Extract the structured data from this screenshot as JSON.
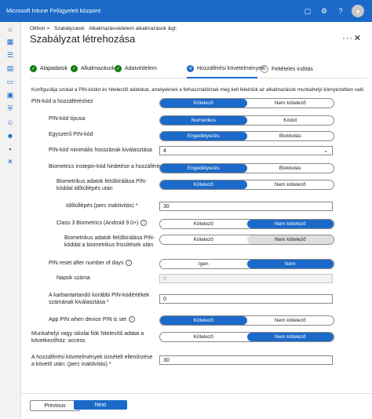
{
  "app": {
    "title": "Microsoft Intune Felügyeleti központ",
    "avatar_letter": "●"
  },
  "nav": [
    "home-icon",
    "dashboard-icon",
    "list-icon",
    "grid-icon",
    "devices-icon",
    "apps-icon",
    "shield-icon",
    "users-icon",
    "groups-icon",
    "admin-icon",
    "tools-icon"
  ],
  "breadcrumb": [
    "Otthon >",
    "Szabályzatok",
    "Alkalmazásvédelem alkalmazások &gt;"
  ],
  "page_title": "Szabályzat létrehozása",
  "more": "···",
  "close": "✕",
  "steps": [
    {
      "label": "Alapadatok",
      "state": "done"
    },
    {
      "label": "Alkalmazások",
      "state": "done"
    },
    {
      "label": "Adatvédelem",
      "state": "done"
    },
    {
      "num": "4",
      "label": "Hozzáférési követelmények",
      "state": "active"
    },
    {
      "num": "5",
      "label": "Feltételes indítás",
      "state": "todo"
    }
  ],
  "description": "Konfigurálja szokat a PIN-kódot és hitelesítő adatokat, amelyeknek a felhasználóknak meg kell felelniük az alkalmazások munkahelyi környezetben való eléréséhez.",
  "rows": {
    "pin_access": {
      "label": "PIN-kód a hozzáféréshez",
      "opt1": "Kötelező",
      "opt2": "Nem kötelező",
      "selected": 1
    },
    "pin_type": {
      "label": "PIN-kód típusa",
      "opt1": "Numerikus",
      "opt2": "Kódot",
      "selected": 1
    },
    "simple_pin": {
      "label": "Egyszerű PIN-kód",
      "opt1": "Engedélyezés",
      "opt2": "Blokkolás",
      "selected": 1
    },
    "min_length": {
      "label": "PIN-kód minimális hosszának kiválasztása",
      "value": "4",
      "chevron": "⌄"
    },
    "biometrics": {
      "label": "Biometrics instepin-kód hirdetése a hozzáféréshez",
      "opt1": "Engedélyezés",
      "opt2": "Blokkolás",
      "selected": 1
    },
    "bio_override": {
      "label": "Biometrikus adatok felülbírálása PIN-kóddal időtúllépés után",
      "opt1": "Kötelező",
      "opt2": "Nem kötelező",
      "selected": 1
    },
    "timeout": {
      "label": "Időtúllépés (perc inaktivitás) *",
      "value": "30"
    },
    "class3": {
      "label": "Class 3 Biometrics (Android 9.0+)",
      "opt1": "Kötelező",
      "opt2": "Nem kötelező",
      "selected": 2
    },
    "bio_update": {
      "label": "Biometrikus adatok felülbírálása PIN-kóddal a biometrikus frissítések után",
      "opt1": "Kötelező",
      "opt2": "Nem kötelező",
      "selected": 2
    },
    "pin_reset": {
      "label": "PIN reset after number of days",
      "opt1": "Igen",
      "opt2": "Nem",
      "selected": 2
    },
    "days": {
      "label": "Napok száma",
      "value": "0"
    },
    "prev_pins": {
      "label": "A karbantartandó korábbi PIN-kódértékek számának kiválasztása *",
      "value": "0"
    },
    "app_pin": {
      "label": "App PIN when device PIN is set",
      "opt1": "Kötelező",
      "opt2": "Nem kötelező",
      "selected": 1
    },
    "work_creds": {
      "label": "Munkahelyi vagy iskolai fiók hitelesítő adatai a következőhöz: access",
      "opt1": "Kötelező",
      "opt2": "Nem kötelező",
      "selected": 2
    },
    "recheck": {
      "label": "A hozzáférési követelmények ismételt ellenőrzése a követő után: (perc inaktivitás) *",
      "value": "30"
    }
  },
  "footer": {
    "previous": "Previous",
    "next": "Next"
  }
}
